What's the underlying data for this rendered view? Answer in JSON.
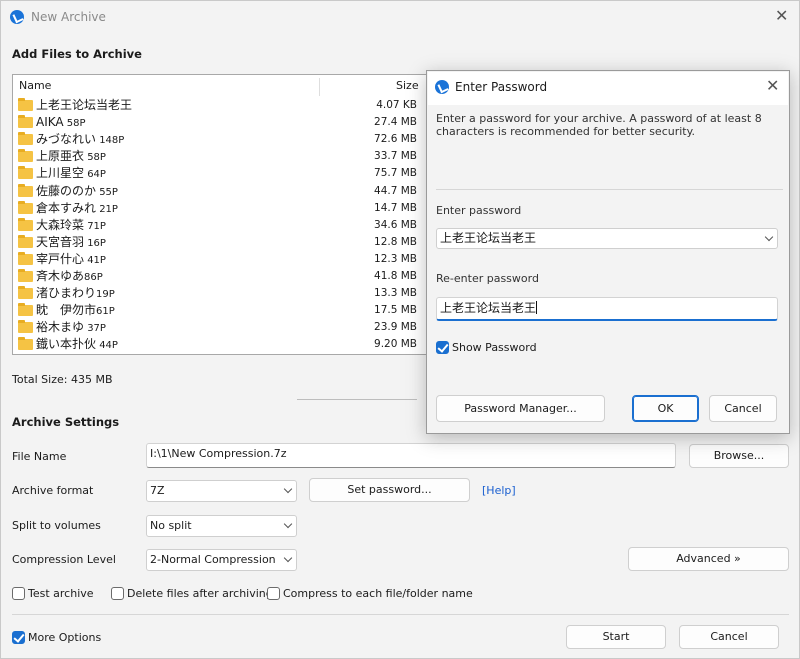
{
  "window": {
    "title": "New Archive"
  },
  "add_files": {
    "heading": "Add Files to Archive",
    "columns": {
      "name": "Name",
      "size": "Size"
    },
    "rows": [
      {
        "name": "上老王论坛当老王",
        "suffix": "",
        "size": "4.07 KB"
      },
      {
        "name": "AIKA",
        "suffix": " 58P",
        "size": "27.4 MB"
      },
      {
        "name": "みづなれい",
        "suffix": " 148P",
        "size": "72.6 MB"
      },
      {
        "name": "上原亜衣",
        "suffix": " 58P",
        "size": "33.7 MB"
      },
      {
        "name": "上川星空",
        "suffix": " 64P",
        "size": "75.7 MB"
      },
      {
        "name": "佐藤ののか",
        "suffix": " 55P",
        "size": "44.7 MB"
      },
      {
        "name": "倉本すみれ",
        "suffix": " 21P",
        "size": "14.7 MB"
      },
      {
        "name": "大森玲菜",
        "suffix": " 71P",
        "size": "34.6 MB"
      },
      {
        "name": "天宮音羽",
        "suffix": " 16P",
        "size": "12.8 MB"
      },
      {
        "name": "宰戸什心",
        "suffix": " 41P",
        "size": "12.3 MB"
      },
      {
        "name": "斉木ゆあ",
        "suffix": "86P",
        "size": "41.8 MB"
      },
      {
        "name": "渚ひまわり",
        "suffix": "19P",
        "size": "13.3 MB"
      },
      {
        "name": "眈　伊勿市",
        "suffix": "61P",
        "size": "17.5 MB"
      },
      {
        "name": "裕木まゆ",
        "suffix": " 37P",
        "size": "23.9 MB"
      },
      {
        "name": "鐡い本扑伙",
        "suffix": " 44P",
        "size": "9.20 MB"
      }
    ],
    "total_size": "Total Size: 435 MB"
  },
  "archive_settings": {
    "heading": "Archive Settings",
    "file_name_label": "File Name",
    "file_name_value": "I:\\1\\New Compression.7z",
    "browse_label": "Browse...",
    "format_label": "Archive format",
    "format_value": "7Z",
    "set_password_label": "Set password...",
    "help_label": "[Help]",
    "split_label": "Split to volumes",
    "split_value": "No split",
    "compression_label": "Compression Level",
    "compression_value": "2-Normal Compression",
    "advanced_label": "Advanced »",
    "test_archive_label": "Test archive",
    "delete_files_label": "Delete files after archiving",
    "compress_each_label": "Compress to each file/folder name",
    "more_options_label": "More Options",
    "start_label": "Start",
    "cancel_label": "Cancel"
  },
  "password_dialog": {
    "title": "Enter Password",
    "description": "Enter a password for your archive. A password of at least 8 characters is recommended for better security.",
    "enter_label": "Enter password",
    "enter_value": "上老王论坛当老王",
    "reenter_label": "Re-enter password",
    "reenter_value": "上老王论坛当老王",
    "show_password_label": "Show Password",
    "manager_label": "Password Manager...",
    "ok_label": "OK",
    "cancel_label": "Cancel"
  },
  "colors": {
    "accent": "#1a6fd0",
    "folder": "#f5c344",
    "link": "#1a5fd0"
  }
}
